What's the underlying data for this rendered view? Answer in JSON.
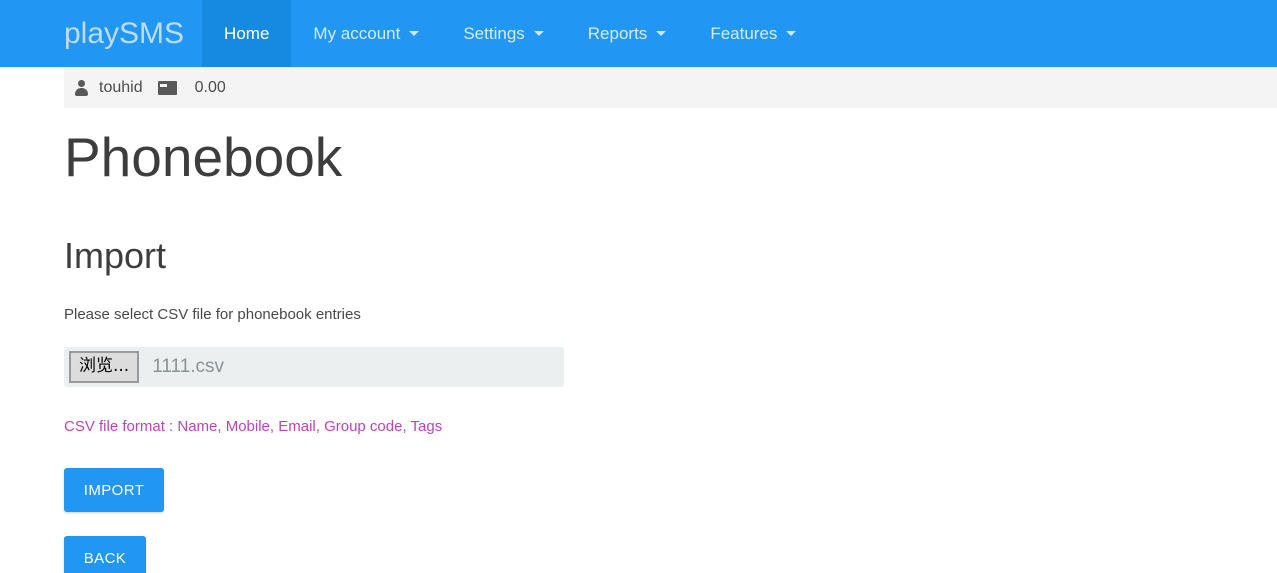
{
  "navbar": {
    "brand": "playSMS",
    "items": [
      {
        "label": "Home",
        "active": true,
        "caret": false
      },
      {
        "label": "My account",
        "active": false,
        "caret": true
      },
      {
        "label": "Settings",
        "active": false,
        "caret": true
      },
      {
        "label": "Reports",
        "active": false,
        "caret": true
      },
      {
        "label": "Features",
        "active": false,
        "caret": true
      }
    ],
    "background_color": "#2196f3",
    "active_color": "#1689e0"
  },
  "userbar": {
    "user_icon": "user-icon",
    "username": "touhid",
    "credit_icon": "credit-card-icon",
    "credit": "0.00"
  },
  "content": {
    "page_title": "Phonebook",
    "section_title": "Import",
    "helper_text": "Please select CSV file for phonebook entries",
    "file_input": {
      "browse_label": "浏览...",
      "file_name": "1111.csv",
      "placeholder": "1111.csv"
    },
    "csv_hint": "CSV file format : Name, Mobile, Email, Group code, Tags",
    "csv_hint_color": "#bb44bb",
    "buttons": {
      "import_label": "IMPORT",
      "back_label": "BACK"
    }
  }
}
